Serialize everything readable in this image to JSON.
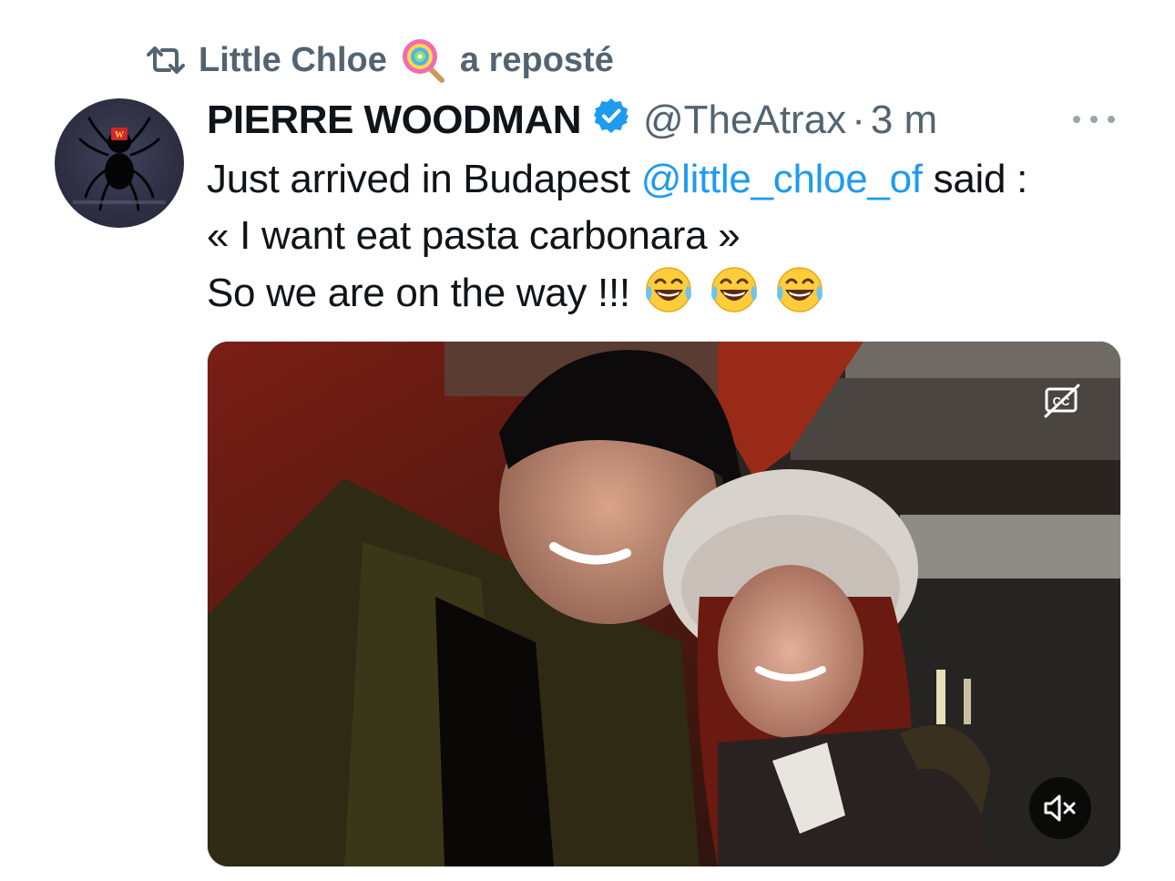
{
  "repost": {
    "user": "Little Chloe",
    "emoji_icon": "lollipop-icon",
    "action": "a reposté"
  },
  "tweet": {
    "author_name": "PIERRE WOODMAN",
    "handle": "@TheAtrax",
    "separator": "·",
    "time": "3 m",
    "verified_color": "#1d9bf0",
    "text": {
      "line1_before": "Just arrived in Budapest ",
      "line1_mention": "@little_chloe_of",
      "line1_after": " said :",
      "line2": "« I want eat pasta carbonara »",
      "line3": "So we are on the way !!!",
      "line3_emojis": [
        "face-with-tears-of-joy-icon",
        "face-with-tears-of-joy-icon",
        "face-with-tears-of-joy-icon"
      ]
    },
    "media": {
      "type": "video",
      "captions_icon": "captions-off-icon",
      "mute_icon": "speaker-muted-icon"
    }
  },
  "colors": {
    "muted_text": "#536471",
    "link": "#1d9bf0",
    "text": "#0f1419"
  }
}
